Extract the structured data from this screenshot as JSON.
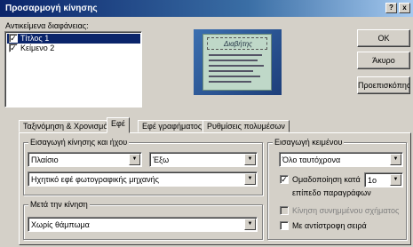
{
  "dialog": {
    "title": "Προσαρμογή κίνησης",
    "help_btn": "?",
    "close_btn": "x"
  },
  "objects": {
    "label": "Αντικείμενα διαφάνειας:",
    "items": [
      {
        "label": "Τίτλος 1",
        "checked": true,
        "selected": true
      },
      {
        "label": "Κείμενο 2",
        "checked": true,
        "selected": false
      }
    ]
  },
  "preview": {
    "slide_title": "Διαβήτης"
  },
  "buttons": {
    "ok": "OK",
    "cancel": "Άκυρο",
    "preview": "Προεπισκόπηση"
  },
  "tabs": [
    {
      "label": "Ταξινόμηση & Χρονισμός",
      "active": false
    },
    {
      "label": "Εφέ",
      "active": true
    },
    {
      "label": "Εφέ γραφήματος",
      "active": false
    },
    {
      "label": "Ρυθμίσεις πολυμέσων",
      "active": false
    }
  ],
  "entry": {
    "group_label": "Εισαγωγή κίνησης και ήχου",
    "effect_value": "Πλαίσιο",
    "direction_value": "Έξω",
    "sound_value": "Ηχητικό εφέ φωτογραφικής μηχανής"
  },
  "after": {
    "group_label": "Μετά την κίνηση",
    "value": "Χωρίς θάμπωμα"
  },
  "text_intro": {
    "group_label": "Εισαγωγή κειμένου",
    "mode_value": "Όλο ταυτόχρονα",
    "grouped_label": "Ομαδοποίηση κατά",
    "grouped_checked": true,
    "level_value": "1o",
    "level_suffix": "επίπεδο παραγράφων",
    "attached_label": "Κίνηση συνημμένου σχήματος",
    "attached_checked": false,
    "reverse_label": "Με αντίστροφη σειρά",
    "reverse_checked": false
  }
}
